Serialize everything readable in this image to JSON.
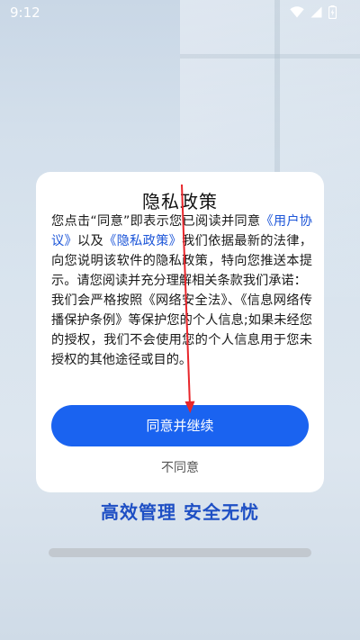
{
  "status_bar": {
    "time": "9:12",
    "icons": [
      "wifi-icon",
      "cellular-signal-icon",
      "battery-charging-icon"
    ]
  },
  "dialog": {
    "title": "隐私政策",
    "body": {
      "p1_before": "您点击“同意”即表示您已阅读并同意",
      "user_agreement_link": "《用户协议》",
      "p1_and": "以及",
      "privacy_policy_link": "《隐私政策》",
      "p1_after": "我们依据最新的法律，向您说明该软件的隐私政策，特向您推送本提示。请您阅读并充分理解相关条款我们承诺：",
      "p2": "我们会严格按照《网络安全法》、《信息网络传播保护条例》等保护您的个人信息;如果未经您的授权，我们不会使用您的个人信息用于您未授权的其他途径或目的。"
    },
    "agree_button": "同意并继续",
    "disagree_button": "不同意"
  },
  "slogan": "高效管理 安全无忧",
  "loading": {
    "progress_fraction": 0.0
  },
  "colors": {
    "accent": "#1a63f0",
    "link": "#1c55d8",
    "slogan": "#1e4fc4",
    "annotation_arrow": "#e8262b"
  }
}
